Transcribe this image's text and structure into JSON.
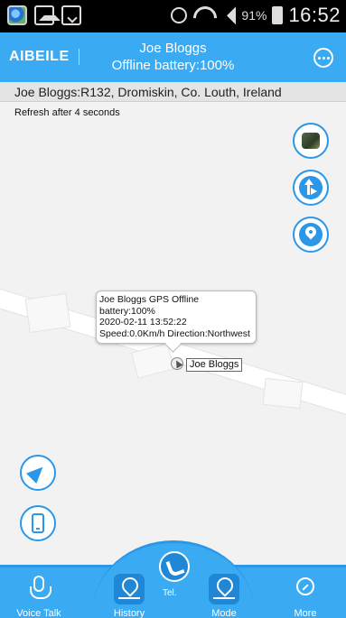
{
  "status_bar": {
    "battery_percent": "91%",
    "time": "16:52"
  },
  "header": {
    "brand": "AIBEILE",
    "title": "Joe Bloggs",
    "subtitle": "Offline battery:100%"
  },
  "address": "Joe Bloggs:R132, Dromiskin, Co. Louth, Ireland",
  "map": {
    "refresh_text": "Refresh after 4 seconds",
    "popup": {
      "line1": "Joe Bloggs GPS Offline",
      "line2": "battery:100%",
      "line3": "2020-02-11 13:52:22",
      "line4": "Speed:0.0Km/h  Direction:Northwest"
    },
    "marker_label": "Joe Bloggs"
  },
  "bottom_nav": {
    "voice_talk": "Voice Talk",
    "history": "History",
    "tel": "Tel.",
    "mode": "Mode",
    "more": "More"
  },
  "colors": {
    "accent": "#3aaaf2",
    "accent_dark": "#2a97e8",
    "status_bar": "#000000"
  }
}
